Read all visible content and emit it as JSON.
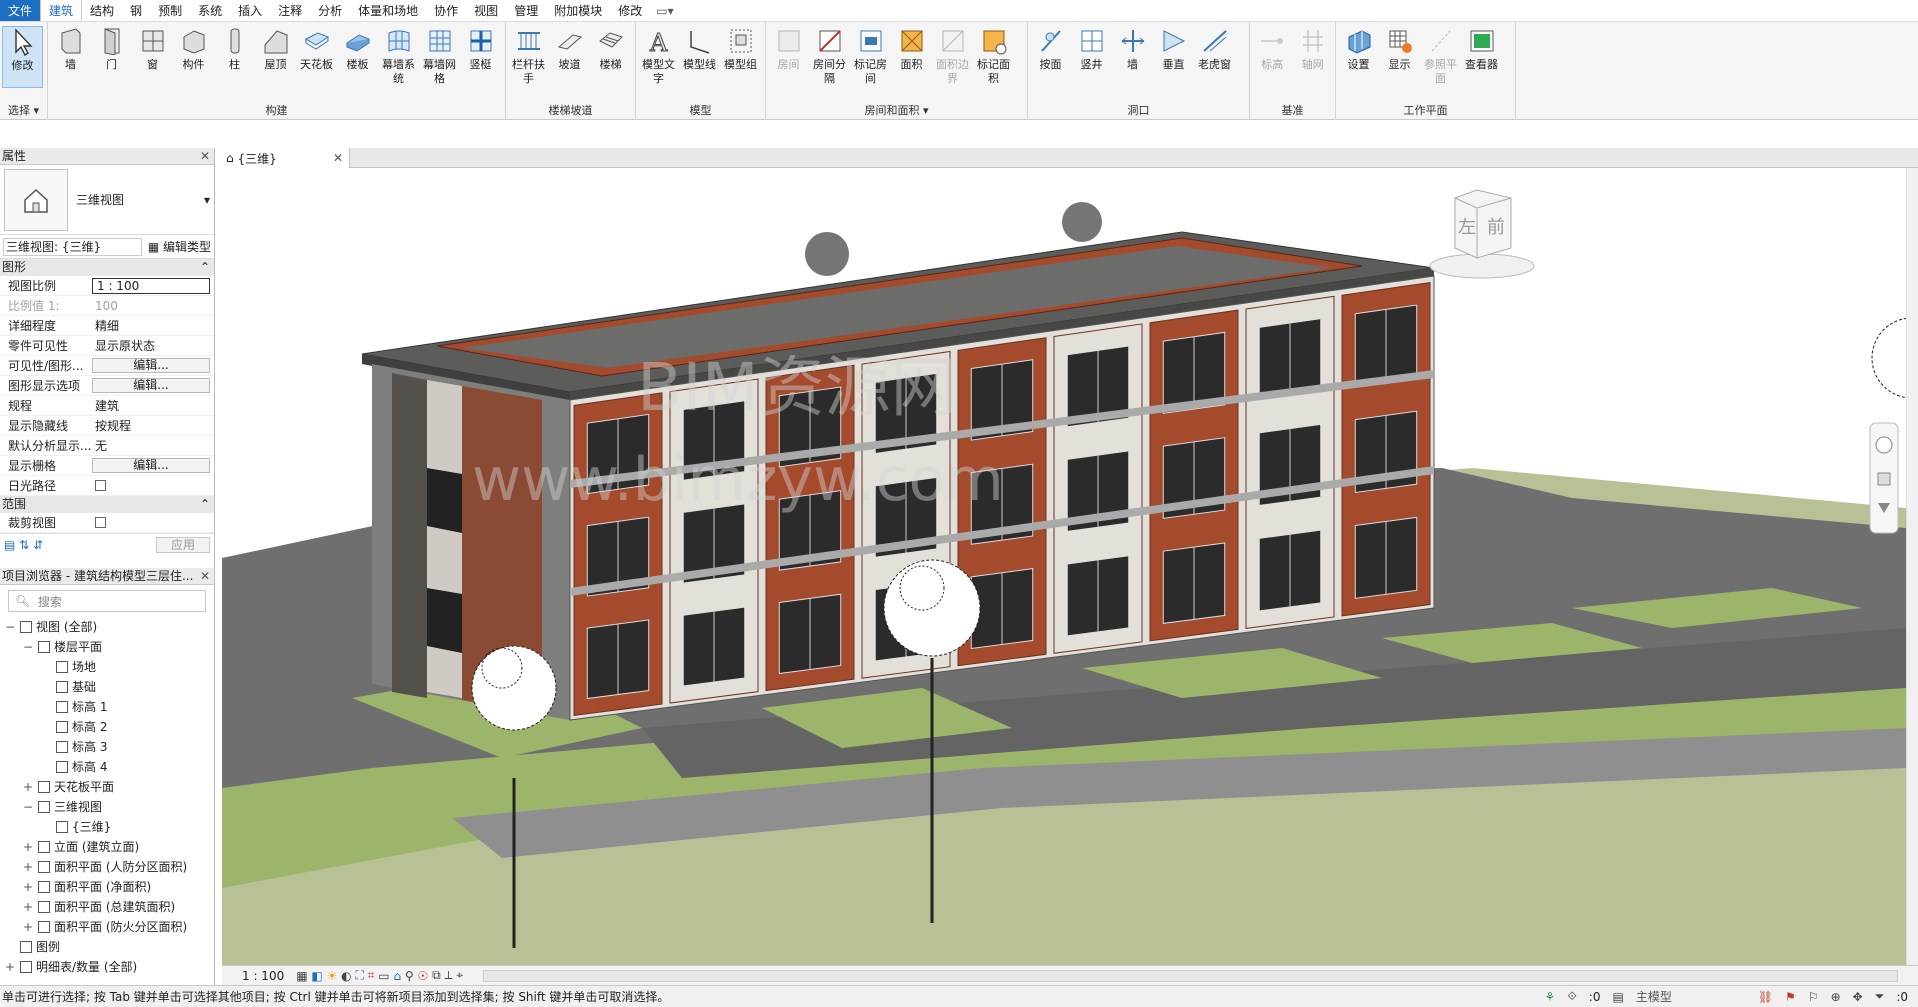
{
  "menu": {
    "tabs": [
      "文件",
      "建筑",
      "结构",
      "钢",
      "预制",
      "系统",
      "插入",
      "注释",
      "分析",
      "体量和场地",
      "协作",
      "视图",
      "管理",
      "附加模块",
      "修改"
    ],
    "active_tab": "建筑"
  },
  "ribbon": {
    "groups": [
      {
        "label": "选择",
        "buttons": [
          {
            "label": "修改"
          }
        ]
      },
      {
        "label": "构建",
        "buttons": [
          {
            "label": "墙"
          },
          {
            "label": "门"
          },
          {
            "label": "窗"
          },
          {
            "label": "构件"
          },
          {
            "label": "柱"
          },
          {
            "label": "屋顶"
          },
          {
            "label": "天花板"
          },
          {
            "label": "楼板"
          },
          {
            "label": "幕墙系统"
          },
          {
            "label": "幕墙网格"
          },
          {
            "label": "竖梃"
          }
        ]
      },
      {
        "label": "楼梯坡道",
        "buttons": [
          {
            "label": "栏杆扶手"
          },
          {
            "label": "坡道"
          },
          {
            "label": "楼梯"
          }
        ]
      },
      {
        "label": "模型",
        "buttons": [
          {
            "label": "模型文字"
          },
          {
            "label": "模型线"
          },
          {
            "label": "模型组"
          }
        ]
      },
      {
        "label": "房间和面积",
        "buttons": [
          {
            "label": "房间",
            "disabled": true
          },
          {
            "label": "房间分隔"
          },
          {
            "label": "标记房间"
          },
          {
            "label": "面积"
          },
          {
            "label": "面积边界",
            "disabled": true
          },
          {
            "label": "标记面积"
          }
        ]
      },
      {
        "label": "洞口",
        "buttons": [
          {
            "label": "按面"
          },
          {
            "label": "竖井"
          },
          {
            "label": "墙"
          },
          {
            "label": "垂直"
          },
          {
            "label": "老虎窗"
          }
        ]
      },
      {
        "label": "基准",
        "buttons": [
          {
            "label": "标高",
            "disabled": true
          },
          {
            "label": "轴网",
            "disabled": true
          }
        ]
      },
      {
        "label": "工作平面",
        "buttons": [
          {
            "label": "设置"
          },
          {
            "label": "显示"
          },
          {
            "label": "参照平面",
            "disabled": true
          },
          {
            "label": "查看器"
          }
        ]
      }
    ]
  },
  "properties": {
    "title": "属性",
    "type_name": "三维视图",
    "view_selector": "三维视图: {三维}",
    "edit_type": "编辑类型",
    "sections": {
      "graphics": "图形",
      "extents": "范围"
    },
    "rows": [
      {
        "k": "视图比例",
        "v": "1 : 100",
        "kind": "box"
      },
      {
        "k": "比例值 1:",
        "v": "100",
        "kind": "dim"
      },
      {
        "k": "详细程度",
        "v": "精细"
      },
      {
        "k": "零件可见性",
        "v": "显示原状态"
      },
      {
        "k": "可见性/图形...",
        "v": "编辑...",
        "kind": "btn"
      },
      {
        "k": "图形显示选项",
        "v": "编辑...",
        "kind": "btn"
      },
      {
        "k": "规程",
        "v": "建筑"
      },
      {
        "k": "显示隐藏线",
        "v": "按规程"
      },
      {
        "k": "默认分析显示...",
        "v": "无"
      },
      {
        "k": "显示栅格",
        "v": "编辑...",
        "kind": "btn"
      },
      {
        "k": "日光路径",
        "v": "",
        "kind": "chk"
      }
    ],
    "crop_row": "裁剪视图",
    "apply": "应用"
  },
  "browser": {
    "title": "项目浏览器 - 建筑结构模型三层住...",
    "search_placeholder": "搜索",
    "tree": [
      {
        "label": "视图 (全部)",
        "level": 0,
        "toggle": "−"
      },
      {
        "label": "楼层平面",
        "level": 1,
        "toggle": "−"
      },
      {
        "label": "场地",
        "level": 2
      },
      {
        "label": "基础",
        "level": 2
      },
      {
        "label": "标高 1",
        "level": 2
      },
      {
        "label": "标高 2",
        "level": 2
      },
      {
        "label": "标高 3",
        "level": 2
      },
      {
        "label": "标高 4",
        "level": 2
      },
      {
        "label": "天花板平面",
        "level": 1,
        "toggle": "+"
      },
      {
        "label": "三维视图",
        "level": 1,
        "toggle": "−"
      },
      {
        "label": "{三维}",
        "level": 2
      },
      {
        "label": "立面 (建筑立面)",
        "level": 1,
        "toggle": "+"
      },
      {
        "label": "面积平面 (人防分区面积)",
        "level": 1,
        "toggle": "+"
      },
      {
        "label": "面积平面 (净面积)",
        "level": 1,
        "toggle": "+"
      },
      {
        "label": "面积平面 (总建筑面积)",
        "level": 1,
        "toggle": "+"
      },
      {
        "label": "面积平面 (防火分区面积)",
        "level": 1,
        "toggle": "+"
      },
      {
        "label": "图例",
        "level": 0
      },
      {
        "label": "明细表/数量 (全部)",
        "level": 0,
        "toggle": "+"
      }
    ]
  },
  "view": {
    "tab_label": "{三维}",
    "viewcube": {
      "left": "左",
      "front": "前"
    },
    "watermark": {
      "line1": "BIM资源网",
      "line2": "www.bimzyw.com"
    },
    "scale": "1 : 100"
  },
  "status": {
    "message": "单击可进行选择; 按 Tab 键并单击可选择其他项目; 按 Ctrl 键并单击可将新项目添加到选择集; 按 Shift 键并单击可取消选择。",
    "count_left": ":0",
    "model": "主模型",
    "filter_count": ":0"
  },
  "colors": {
    "accent": "#1b6ec2",
    "brick": "#a44a2d",
    "panel": "#e3e0da",
    "roof": "#5c5c5a",
    "grass": "#9bb86a",
    "road": "#7a7a7a"
  }
}
